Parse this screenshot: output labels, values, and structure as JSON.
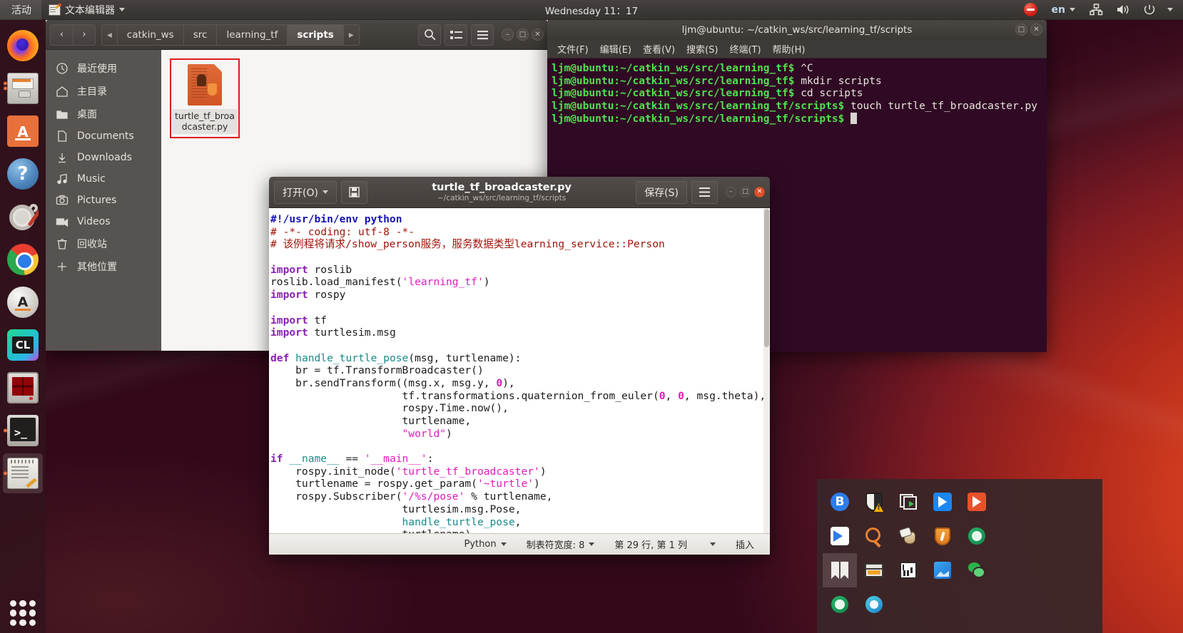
{
  "topbar": {
    "activities": "活动",
    "app_name": "文本编辑器",
    "app_icon": "text-editor-icon",
    "clock": "Wednesday 11：17",
    "do_not_disturb_icon": "no-entry-icon",
    "keyboard_layout": "en",
    "network_icon": "network-icon",
    "volume_icon": "volume-icon",
    "power_icon": "power-icon"
  },
  "launcher": {
    "items": [
      {
        "name": "firefox",
        "icon": "firefox-icon",
        "running": false
      },
      {
        "name": "files",
        "icon": "file-manager-icon",
        "running": true
      },
      {
        "name": "ubuntu-software",
        "icon": "ubuntu-software-icon",
        "running": false
      },
      {
        "name": "help",
        "icon": "help-icon",
        "running": false
      },
      {
        "name": "system-settings",
        "icon": "settings-icon",
        "running": false
      },
      {
        "name": "chrome",
        "icon": "chrome-icon",
        "running": false
      },
      {
        "name": "amazon",
        "icon": "amazon-icon",
        "running": false
      },
      {
        "name": "clion",
        "icon": "clion-icon",
        "running": false
      },
      {
        "name": "virtualbox",
        "icon": "virtualbox-icon",
        "running": false
      },
      {
        "name": "terminal",
        "icon": "terminal-icon",
        "running": true
      },
      {
        "name": "text-editor",
        "icon": "gedit-icon",
        "running": true
      }
    ],
    "show_applications": "show-applications-icon"
  },
  "file_manager": {
    "window_name": "nautilus",
    "nav": {
      "back": "‹",
      "forward": "›"
    },
    "breadcrumb_left_arrow": "◂",
    "breadcrumb_right_arrow": "▸",
    "breadcrumbs": [
      {
        "label": "catkin_ws",
        "current": false
      },
      {
        "label": "src",
        "current": false
      },
      {
        "label": "learning_tf",
        "current": false
      },
      {
        "label": "scripts",
        "current": true
      }
    ],
    "toolbar_icons": [
      "search-icon",
      "view-list-icon",
      "menu-icon"
    ],
    "window_buttons": [
      "minimize-icon",
      "maximize-icon",
      "close-icon"
    ],
    "sidebar": [
      {
        "label": "最近使用",
        "icon": "clock-icon"
      },
      {
        "label": "主目录",
        "icon": "home-icon"
      },
      {
        "label": "桌面",
        "icon": "folder-icon"
      },
      {
        "label": "Documents",
        "icon": "document-icon"
      },
      {
        "label": "Downloads",
        "icon": "download-icon"
      },
      {
        "label": "Music",
        "icon": "music-icon"
      },
      {
        "label": "Pictures",
        "icon": "camera-icon"
      },
      {
        "label": "Videos",
        "icon": "video-icon"
      },
      {
        "label": "回收站",
        "icon": "trash-icon"
      },
      {
        "label": "其他位置",
        "icon": "plus-icon"
      }
    ],
    "files": [
      {
        "name": "turtle_tf_broadcaster.py",
        "icon": "python-file-icon",
        "selected": true
      }
    ]
  },
  "terminal": {
    "title": "ljm@ubuntu: ~/catkin_ws/src/learning_tf/scripts",
    "window_buttons": [
      "maximize-icon",
      "close-icon"
    ],
    "menu": [
      "文件(F)",
      "编辑(E)",
      "查看(V)",
      "搜索(S)",
      "终端(T)",
      "帮助(H)"
    ],
    "lines": [
      {
        "prompt": "ljm@ubuntu:~/catkin_ws/src/learning_tf$",
        "command": " ^C"
      },
      {
        "prompt": "ljm@ubuntu:~/catkin_ws/src/learning_tf$",
        "command": " mkdir scripts"
      },
      {
        "prompt": "ljm@ubuntu:~/catkin_ws/src/learning_tf$",
        "command": " cd scripts"
      },
      {
        "prompt": "ljm@ubuntu:~/catkin_ws/src/learning_tf/scripts$",
        "command": " touch turtle_tf_broadcaster.py"
      },
      {
        "prompt": "ljm@ubuntu:~/catkin_ws/src/learning_tf/scripts$",
        "command": " "
      }
    ]
  },
  "editor": {
    "open_button": "打开(O)",
    "save_icon_button": "save-icon",
    "title": "turtle_tf_broadcaster.py",
    "subtitle": "~/catkin_ws/src/learning_tf/scripts",
    "save_button": "保存(S)",
    "menu_button": "menu-icon",
    "window_buttons": [
      "minimize-icon",
      "maximize-icon",
      "close-icon"
    ],
    "code": "#!/usr/bin/env python\n# -*- coding: utf-8 -*-\n# 该例程将请求/show_person服务，服务数据类型learning_service::Person\n\nimport roslib\nroslib.load_manifest('learning_tf')\nimport rospy\n\nimport tf\nimport turtlesim.msg\n\ndef handle_turtle_pose(msg, turtlename):\n    br = tf.TransformBroadcaster()\n    br.sendTransform((msg.x, msg.y, 0),\n                     tf.transformations.quaternion_from_euler(0, 0, msg.theta),\n                     rospy.Time.now(),\n                     turtlename,\n                     \"world\")\n\nif __name__ == '__main__':\n    rospy.init_node('turtle_tf_broadcaster')\n    turtlename = rospy.get_param('~turtle')\n    rospy.Subscriber('/%s/pose' % turtlename,\n                     turtlesim.msg.Pose,\n                     handle_turtle_pose,\n                     turtlename)\n    rospy.spin()",
    "status": {
      "language": "Python",
      "tab_width": "制表符宽度: 8",
      "position": "第 29 行, 第 1 列",
      "mode": "插入"
    }
  },
  "tray": {
    "items": [
      {
        "name": "bluetooth",
        "icon": "bluetooth-icon",
        "selected": false
      },
      {
        "name": "security-warning",
        "icon": "shield-warning-icon",
        "selected": false
      },
      {
        "name": "screen-record",
        "icon": "copy-play-icon",
        "selected": false
      },
      {
        "name": "media-player",
        "icon": "blue-arrow-icon",
        "selected": false
      },
      {
        "name": "teamviewer",
        "icon": "teamviewer-icon",
        "selected": false
      },
      {
        "name": "search-tool",
        "icon": "magnifier-icon",
        "selected": false
      },
      {
        "name": "mouse-settings",
        "icon": "mouse-icon",
        "selected": false
      },
      {
        "name": "firewall",
        "icon": "orange-shield-icon",
        "selected": false
      },
      {
        "name": "bookmarks",
        "icon": "bookmark-icon",
        "selected": true
      },
      {
        "name": "window-manager",
        "icon": "window-icon",
        "selected": false
      },
      {
        "name": "system-monitor",
        "icon": "chart-icon",
        "selected": false
      },
      {
        "name": "image-viewer",
        "icon": "picture-icon",
        "selected": false
      },
      {
        "name": "wechat",
        "icon": "wechat-icon",
        "selected": false
      },
      {
        "name": "green-browser",
        "icon": "green-globe-icon",
        "selected": false
      },
      {
        "name": "edge-browser",
        "icon": "edge-icon",
        "selected": false
      }
    ]
  },
  "colors": {
    "accent": "#e8703a",
    "terminal_bg": "#300a24",
    "selection_red": "#e01b1b",
    "panel": "#3d3936"
  }
}
